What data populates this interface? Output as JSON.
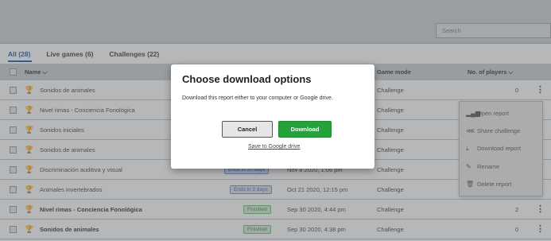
{
  "search": {
    "placeholder": "Search"
  },
  "tabs": [
    {
      "label": "All (28)"
    },
    {
      "label": "Live games (6)"
    },
    {
      "label": "Challenges (22)"
    }
  ],
  "table": {
    "headers": {
      "name": "Name ⌵",
      "mode": "Game mode",
      "players": "No. of players ⌵"
    },
    "rows": [
      {
        "name": "Sonidos de animales",
        "status": "",
        "date": "",
        "mode": "Challenge",
        "players": "0"
      },
      {
        "name": "Nivel rimas - Conciencia Fonológica",
        "status": "",
        "date": "",
        "mode": "Challenge",
        "players": ""
      },
      {
        "name": "Sonidos iniciales",
        "status": "",
        "date": "",
        "mode": "Challenge",
        "players": ""
      },
      {
        "name": "Sonidos de animales",
        "status": "",
        "date": "",
        "mode": "Challenge",
        "players": ""
      },
      {
        "name": "Discriminación auditiva y visual",
        "status": "Ends in 20 days",
        "date": "Nov 8 2020, 1:06 pm",
        "mode": "Challenge",
        "players": ""
      },
      {
        "name": "Animales invertebrados",
        "status": "Ends in 2 days",
        "date": "Oct 21 2020, 12:15 pm",
        "mode": "Challenge",
        "players": ""
      },
      {
        "name": "Nivel rimas - Conciencia Fonológica",
        "status": "Finished",
        "date": "Sep 30 2020, 4:44 pm",
        "mode": "Challenge",
        "players": "2"
      },
      {
        "name": "Sonidos de animales",
        "status": "Finished",
        "date": "Sep 30 2020, 4:38 pm",
        "mode": "Challenge",
        "players": "0"
      }
    ]
  },
  "context_menu": [
    {
      "label": "Open report",
      "icon": "bar-chart-icon"
    },
    {
      "label": "Share challenge",
      "icon": "share-icon"
    },
    {
      "label": "Download report",
      "icon": "download-icon"
    },
    {
      "label": "Rename",
      "icon": "pencil-icon"
    },
    {
      "label": "Delete report",
      "icon": "trash-icon"
    }
  ],
  "modal": {
    "title": "Choose download options",
    "description": "Download this report either to your computer or Google drive.",
    "cancel_label": "Cancel",
    "download_label": "Download",
    "drive_link": "Save to Google drive"
  },
  "colors": {
    "accent": "#1b5dab",
    "download_button": "#24a33a",
    "trophy": "#d79a1a"
  }
}
